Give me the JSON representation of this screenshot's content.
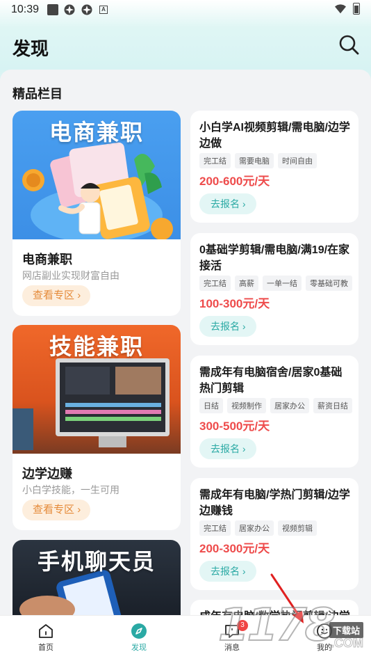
{
  "status_bar": {
    "time": "10:39"
  },
  "header": {
    "title": "发现"
  },
  "section": {
    "title": "精品栏目"
  },
  "features": [
    {
      "banner": "电商兼职",
      "name": "电商兼职",
      "sub": "网店副业实现财富自由",
      "button": "查看专区"
    },
    {
      "banner": "技能兼职",
      "name": "边学边赚",
      "sub": "小白学技能，一生可用",
      "button": "查看专区"
    },
    {
      "banner": "手机聊天员"
    }
  ],
  "jobs": [
    {
      "title": "小白学AI视频剪辑/需电脑/边学边做",
      "tags": [
        "完工结",
        "需要电脑",
        "时间自由"
      ],
      "pay": "200-600元/天",
      "button": "去报名"
    },
    {
      "title": "0基础学剪辑/需电脑/满19/在家接活",
      "tags": [
        "完工结",
        "高薪",
        "一单一结",
        "零基础可教"
      ],
      "pay": "100-300元/天",
      "button": "去报名"
    },
    {
      "title": "需成年有电脑宿舍/居家0基础热门剪辑",
      "tags": [
        "日结",
        "视频制作",
        "居家办公",
        "薪资日结"
      ],
      "pay": "300-500元/天",
      "button": "去报名"
    },
    {
      "title": "需成年有电脑/学热门剪辑/边学边赚钱",
      "tags": [
        "完工结",
        "居家办公",
        "视频剪辑"
      ],
      "pay": "200-300元/天",
      "button": "去报名"
    },
    {
      "title": "成年有电脑/数学热门剪辑/边学"
    }
  ],
  "nav": {
    "home": "首页",
    "discover": "发现",
    "messages": "消息",
    "messages_badge": "3",
    "mine": "我的"
  },
  "watermark": {
    "digits": "1178",
    "tag": "下载站",
    "com": ".COM"
  },
  "colors": {
    "accent": "#2aa9a4",
    "price": "#ee4b4b",
    "orange": "#e58b3a"
  }
}
